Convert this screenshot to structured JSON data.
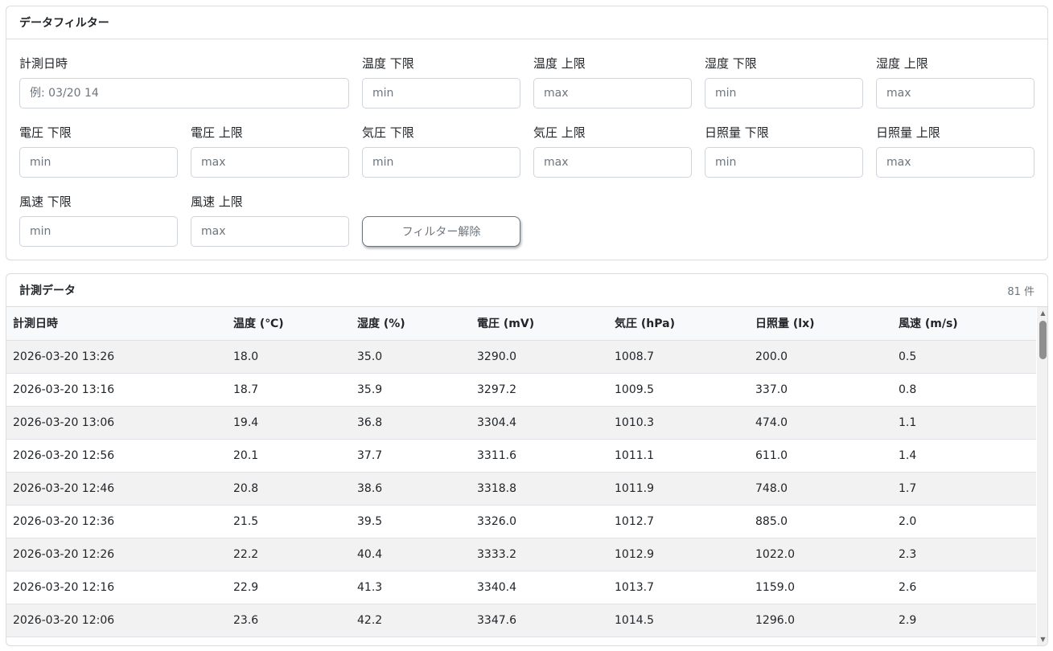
{
  "filter": {
    "title": "データフィルター",
    "fields": [
      {
        "label": "計測日時",
        "placeholder": "例: 03/20 14"
      },
      {
        "label": "温度 下限",
        "placeholder": "min"
      },
      {
        "label": "温度 上限",
        "placeholder": "max"
      },
      {
        "label": "湿度 下限",
        "placeholder": "min"
      },
      {
        "label": "湿度 上限",
        "placeholder": "max"
      },
      {
        "label": "電圧 下限",
        "placeholder": "min"
      },
      {
        "label": "電圧 上限",
        "placeholder": "max"
      },
      {
        "label": "気圧 下限",
        "placeholder": "min"
      },
      {
        "label": "気圧 上限",
        "placeholder": "max"
      },
      {
        "label": "日照量 下限",
        "placeholder": "min"
      },
      {
        "label": "日照量 上限",
        "placeholder": "max"
      },
      {
        "label": "風速 下限",
        "placeholder": "min"
      },
      {
        "label": "風速 上限",
        "placeholder": "max"
      }
    ],
    "clear_label": "フィルター解除"
  },
  "data": {
    "title": "計測データ",
    "count": "81 件",
    "columns": [
      "計測日時",
      "温度 (℃)",
      "湿度 (%)",
      "電圧 (mV)",
      "気圧 (hPa)",
      "日照量 (lx)",
      "風速 (m/s)"
    ],
    "rows": [
      [
        "2026-03-20 13:26",
        "18.0",
        "35.0",
        "3290.0",
        "1008.7",
        "200.0",
        "0.5"
      ],
      [
        "2026-03-20 13:16",
        "18.7",
        "35.9",
        "3297.2",
        "1009.5",
        "337.0",
        "0.8"
      ],
      [
        "2026-03-20 13:06",
        "19.4",
        "36.8",
        "3304.4",
        "1010.3",
        "474.0",
        "1.1"
      ],
      [
        "2026-03-20 12:56",
        "20.1",
        "37.7",
        "3311.6",
        "1011.1",
        "611.0",
        "1.4"
      ],
      [
        "2026-03-20 12:46",
        "20.8",
        "38.6",
        "3318.8",
        "1011.9",
        "748.0",
        "1.7"
      ],
      [
        "2026-03-20 12:36",
        "21.5",
        "39.5",
        "3326.0",
        "1012.7",
        "885.0",
        "2.0"
      ],
      [
        "2026-03-20 12:26",
        "22.2",
        "40.4",
        "3333.2",
        "1012.9",
        "1022.0",
        "2.3"
      ],
      [
        "2026-03-20 12:16",
        "22.9",
        "41.3",
        "3340.4",
        "1013.7",
        "1159.0",
        "2.6"
      ],
      [
        "2026-03-20 12:06",
        "23.6",
        "42.2",
        "3347.6",
        "1014.5",
        "1296.0",
        "2.9"
      ]
    ]
  },
  "icons": {
    "scroll_up": "scroll-up-arrow",
    "scroll_down": "scroll-down-arrow"
  },
  "colors": {
    "row_stripe": "#f2f2f2",
    "header_bg": "#f8f9fa",
    "border": "#dcdcdc",
    "button_border": "#6c757d"
  }
}
